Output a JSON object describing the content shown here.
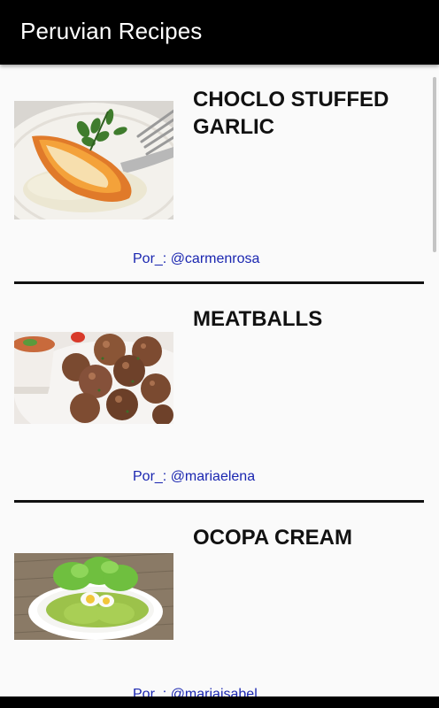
{
  "app": {
    "title": "Peruvian Recipes"
  },
  "recipes": [
    {
      "title": "CHOCLO STUFFED GARLIC",
      "author": "Por_: @carmenrosa"
    },
    {
      "title": "MEATBALLS",
      "author": "Por_: @mariaelena"
    },
    {
      "title": "OCOPA CREAM",
      "author": "Por_: @mariaisabel"
    }
  ],
  "colors": {
    "app_bar": "#000000",
    "background": "#fafafa",
    "title_text": "#111111",
    "author_text": "#1a26b0",
    "divider": "#111111"
  }
}
